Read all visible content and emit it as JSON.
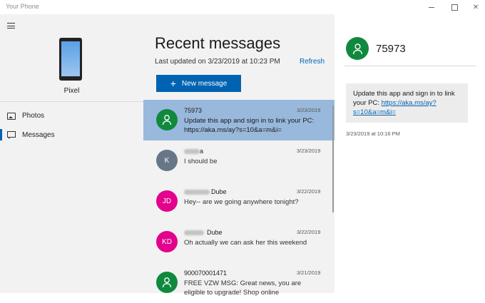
{
  "app": {
    "title": "Your Phone"
  },
  "colors": {
    "accent": "#0063b1",
    "selected_row": "#99b9dc",
    "green_avatar": "#10893e",
    "gray_avatar": "#68768a",
    "pink_avatar": "#e3008c"
  },
  "sidebar": {
    "device_name": "Pixel",
    "items": [
      {
        "label": "Photos",
        "icon": "photos-icon"
      },
      {
        "label": "Messages",
        "icon": "messages-icon",
        "selected": true
      }
    ]
  },
  "messages": {
    "heading": "Recent messages",
    "last_updated": "Last updated on 3/23/2019 at 10:23 PM",
    "refresh_label": "Refresh",
    "new_message_label": "New message",
    "threads": [
      {
        "name": "75973",
        "initials": "",
        "avatar": "person-icon",
        "date": "3/23/2019",
        "preview": "Update this app and sign in to link your PC: https://aka.ms/ay?s=10&a=m&i="
      },
      {
        "name": "a",
        "initials": "K",
        "avatar": "initials",
        "date": "3/23/2019",
        "preview": "I should be"
      },
      {
        "name": "Dube",
        "initials": "JD",
        "avatar": "initials",
        "date": "3/22/2019",
        "preview": "Hey-- are we going anywhere tonight?"
      },
      {
        "name": "Dube",
        "initials": "KD",
        "avatar": "initials",
        "date": "3/22/2019",
        "preview": "Oh actually we can ask her this weekend"
      },
      {
        "name": "900070001471",
        "initials": "",
        "avatar": "person-icon",
        "date": "3/21/2019",
        "preview": "FREE VZW MSG: Great news, you are eligible to upgrade! Shop online"
      }
    ]
  },
  "conversation": {
    "contact": "75973",
    "message_text": "Update this app and sign in to link your PC: ",
    "message_link": "https://aka.ms/ay?s=10&a=m&i=",
    "timestamp": "3/23/2019 at 10:16 PM"
  }
}
